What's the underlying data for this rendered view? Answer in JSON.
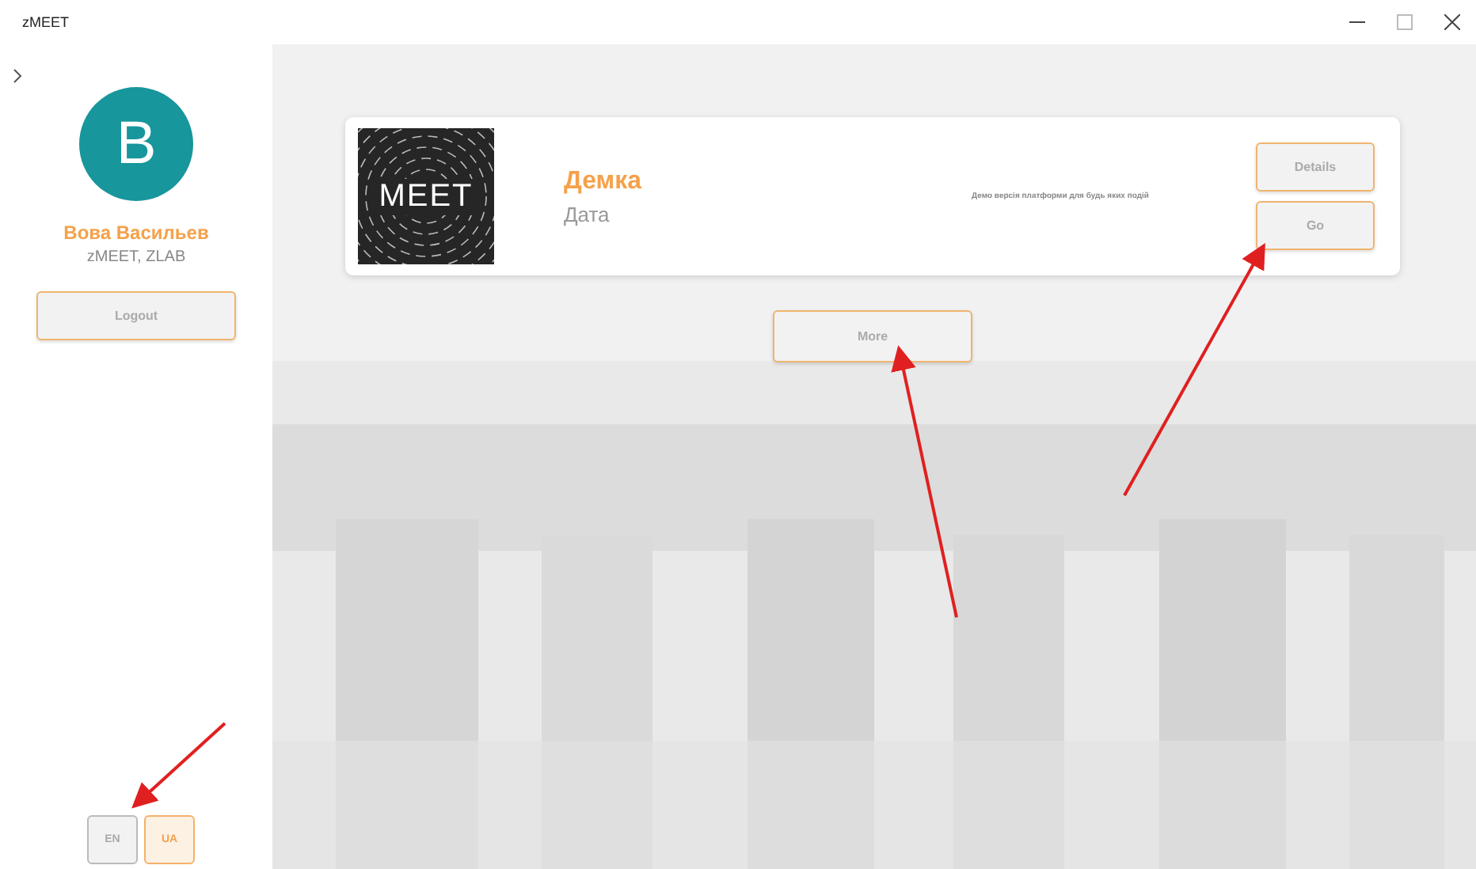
{
  "window": {
    "title": "zMEET"
  },
  "user": {
    "initial": "В",
    "name": "Вова Васильев",
    "org": "zMEET, ZLAB"
  },
  "logout": "Logout",
  "languages": [
    {
      "label": "EN",
      "selected": false
    },
    {
      "label": "UA",
      "selected": true
    }
  ],
  "events": [
    {
      "title": "Демка",
      "date": "Дата",
      "description": "Демо версія платформи для будь яких подій",
      "logo": "MEET",
      "buttons": [
        "Details",
        "Go"
      ]
    }
  ],
  "more": "More"
}
